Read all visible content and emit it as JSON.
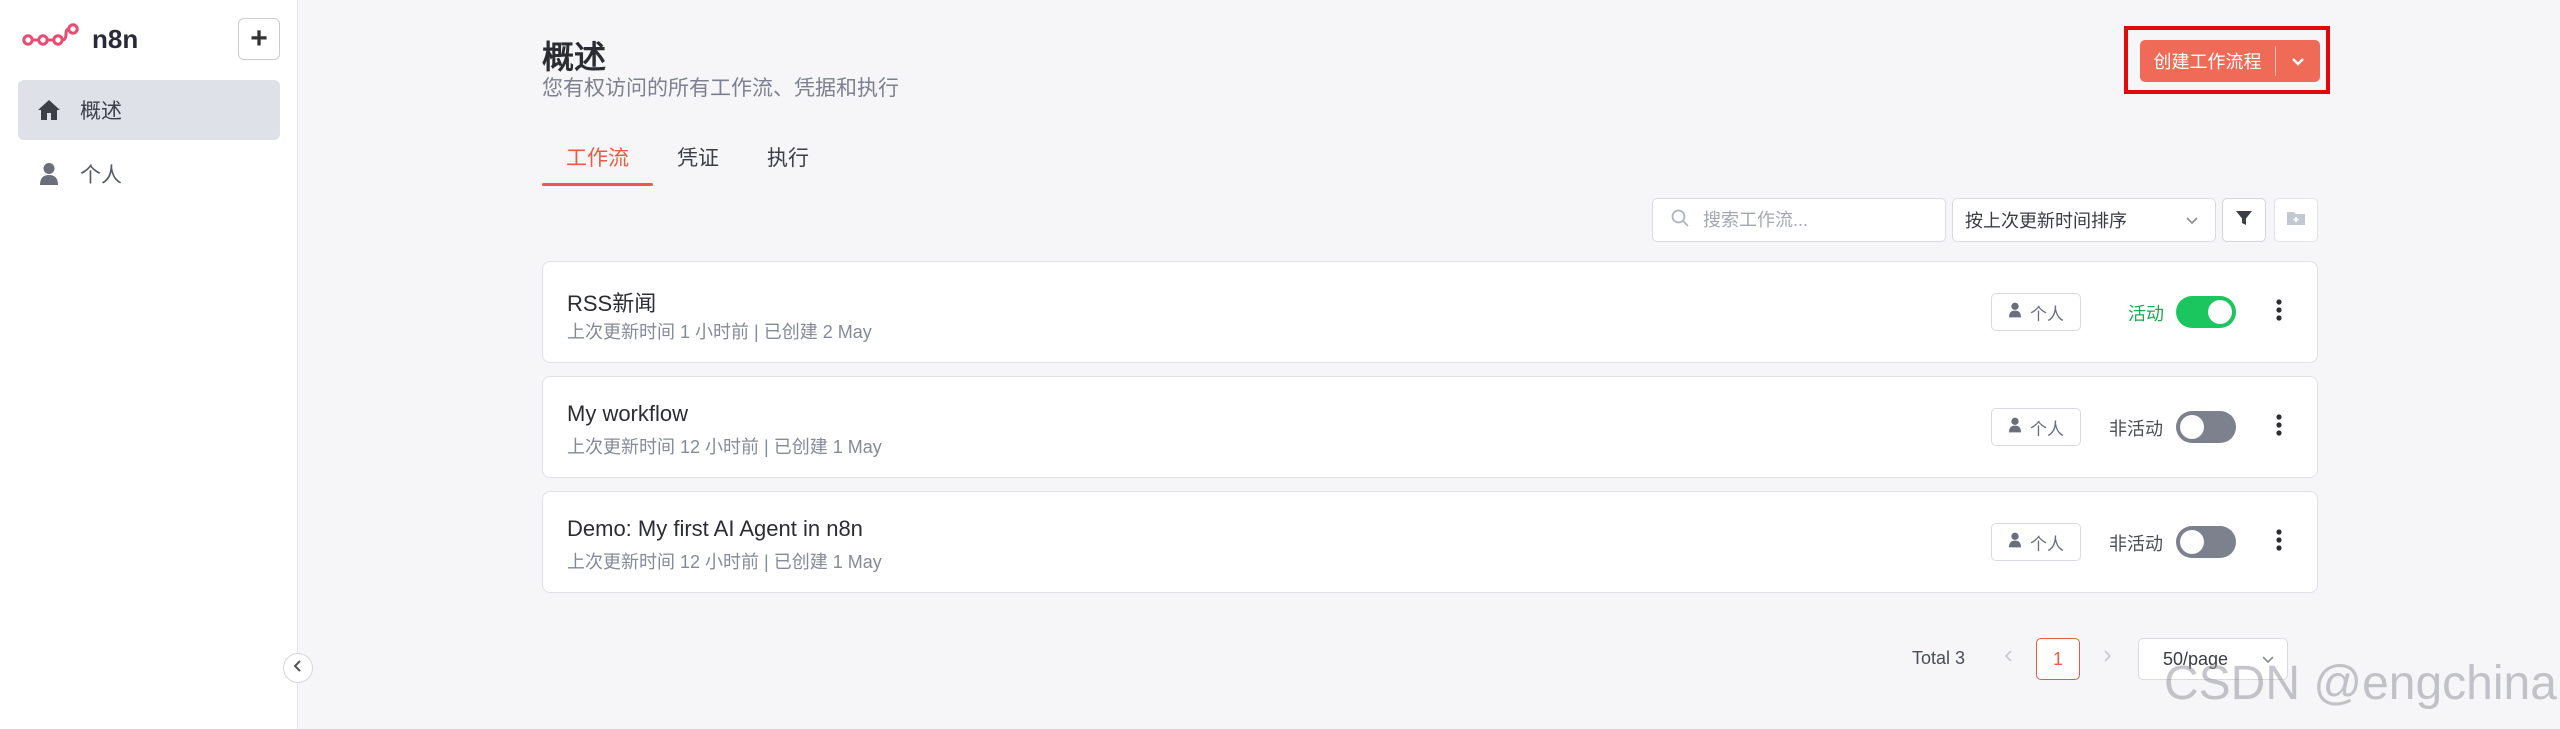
{
  "app": {
    "name": "n8n"
  },
  "sidebar": {
    "add_label": "+",
    "items": [
      {
        "label": "概述",
        "icon": "home-icon",
        "active": true
      },
      {
        "label": "个人",
        "icon": "user-icon",
        "active": false
      }
    ]
  },
  "header": {
    "title": "概述",
    "subtitle": "您有权访问的所有工作流、凭据和执行",
    "create_button": "创建工作流程"
  },
  "tabs": [
    {
      "label": "工作流",
      "active": true
    },
    {
      "label": "凭证",
      "active": false
    },
    {
      "label": "执行",
      "active": false
    }
  ],
  "toolbar": {
    "search_placeholder": "搜索工作流...",
    "sort_value": "按上次更新时间排序"
  },
  "workflows": [
    {
      "name": "RSS新闻",
      "meta": "上次更新时间 1 小时前 | 已创建 2 May",
      "owner": "个人",
      "status": "活动",
      "active": true
    },
    {
      "name": "My workflow",
      "meta": "上次更新时间 12 小时前 | 已创建 1 May",
      "owner": "个人",
      "status": "非活动",
      "active": false
    },
    {
      "name": "Demo: My first AI Agent in n8n",
      "meta": "上次更新时间 12 小时前 | 已创建 1 May",
      "owner": "个人",
      "status": "非活动",
      "active": false
    }
  ],
  "pagination": {
    "total": "Total 3",
    "current_page": "1",
    "page_size": "50/page"
  },
  "watermark": "CSDN @engchina",
  "colors": {
    "accent": "#ea5b45",
    "button": "#ef6b57",
    "active_green": "#1cc65e",
    "inactive_gray": "#7d818d",
    "highlight_box": "#e10a0a"
  }
}
